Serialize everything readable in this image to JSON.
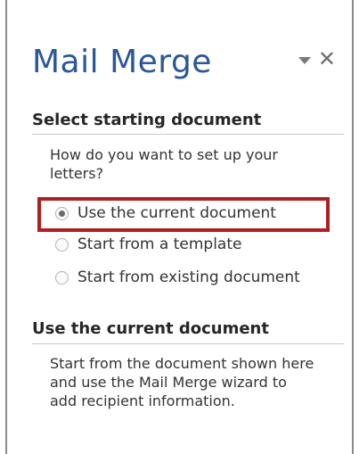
{
  "pane": {
    "title": "Mail Merge",
    "dropdown_icon": "chevron-down-icon",
    "close_icon": "close-icon",
    "close_glyph": "✕"
  },
  "select_section": {
    "heading": "Select starting document",
    "question": "How do you want to set up your letters?",
    "options": [
      {
        "label": "Use the current document",
        "checked": true
      },
      {
        "label": "Start from a template",
        "checked": false
      },
      {
        "label": "Start from existing document",
        "checked": false
      }
    ]
  },
  "info_section": {
    "heading": "Use the current document",
    "description": "Start from the document shown here and use the Mail Merge wizard to add recipient information."
  },
  "colors": {
    "title": "#2b579a",
    "highlight": "#b01e23"
  }
}
